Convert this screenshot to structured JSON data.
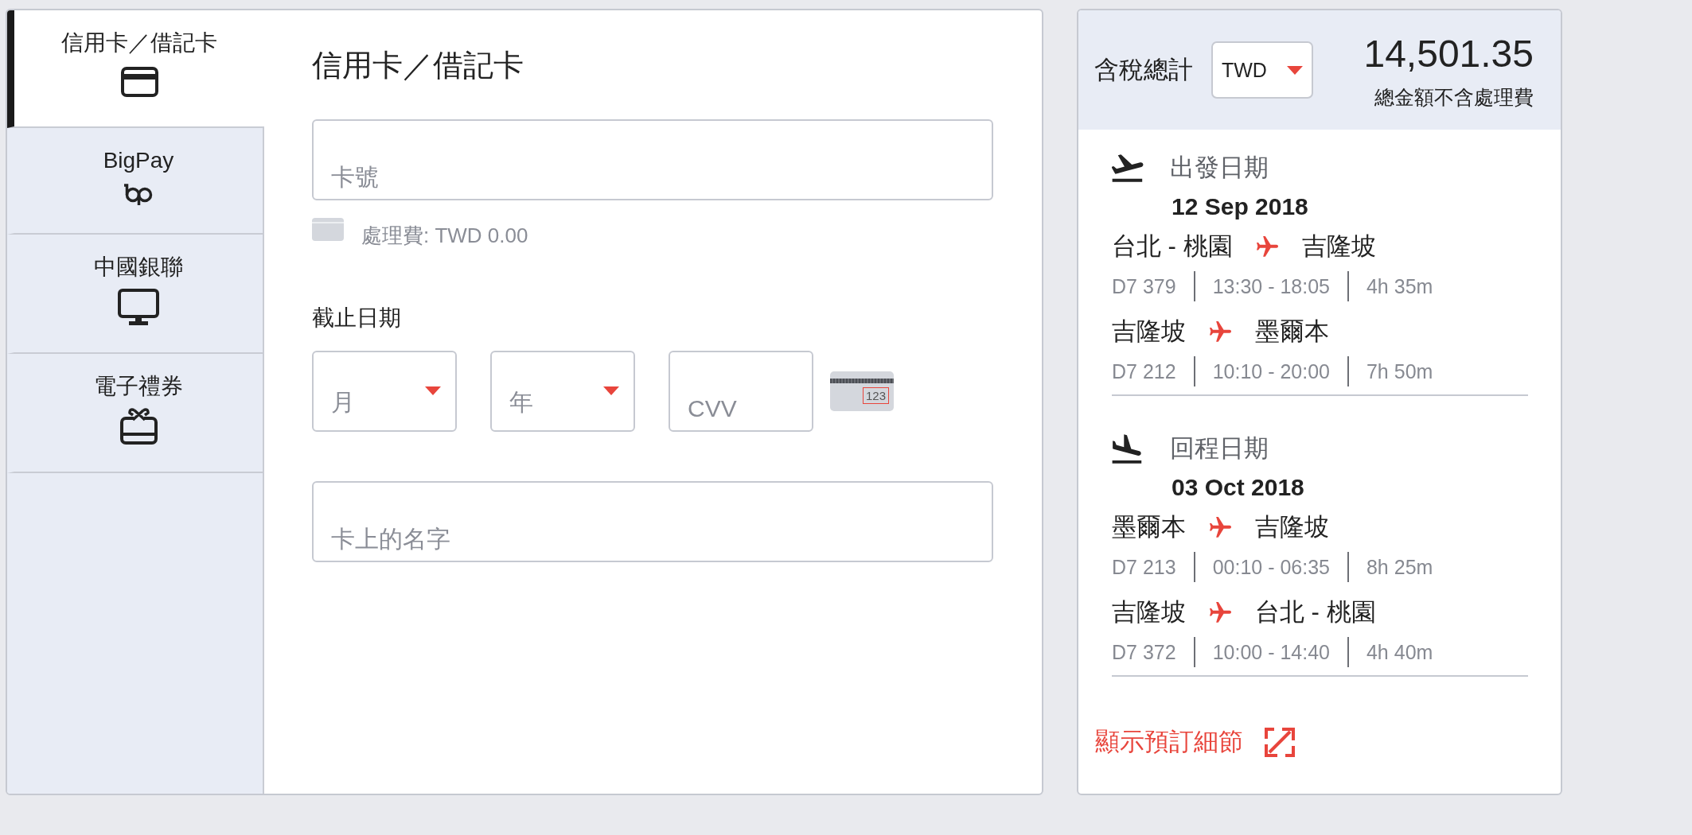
{
  "payment_tabs": [
    {
      "label": "信用卡／借記卡",
      "kind": "card",
      "selected": true
    },
    {
      "label": "BigPay",
      "kind": "bigpay",
      "selected": false
    },
    {
      "label": "中國銀聯",
      "kind": "unionpay",
      "selected": false
    },
    {
      "label": "電子禮券",
      "kind": "voucher",
      "selected": false
    }
  ],
  "card_form": {
    "title": "信用卡／借記卡",
    "card_number": {
      "placeholder": "卡號"
    },
    "fee": "處理費: TWD 0.00",
    "expiry": {
      "label": "截止日期",
      "month": {
        "placeholder": "月"
      },
      "year": {
        "placeholder": "年"
      }
    },
    "cvv": {
      "placeholder": "CVV",
      "example": "123"
    },
    "name_on_card": {
      "placeholder": "卡上的名字"
    }
  },
  "summary": {
    "total_label": "含稅總計",
    "currency": "TWD",
    "total": "14,501.35",
    "total_note": "總金額不含處理費",
    "trips": [
      {
        "kind": "departure",
        "label": "出發日期",
        "date": "12 Sep 2018",
        "segments": [
          {
            "from": "台北 - 桃園",
            "to": "吉隆坡",
            "flight": "D7 379",
            "time": "13:30 - 18:05",
            "duration": "4h 35m"
          },
          {
            "from": "吉隆坡",
            "to": "墨爾本",
            "flight": "D7 212",
            "time": "10:10 - 20:00",
            "duration": "7h 50m"
          }
        ]
      },
      {
        "kind": "return",
        "label": "回程日期",
        "date": "03 Oct 2018",
        "segments": [
          {
            "from": "墨爾本",
            "to": "吉隆坡",
            "flight": "D7 213",
            "time": "00:10 - 06:35",
            "duration": "8h 25m"
          },
          {
            "from": "吉隆坡",
            "to": "台北 - 桃園",
            "flight": "D7 372",
            "time": "10:00 - 14:40",
            "duration": "4h 40m"
          }
        ]
      }
    ],
    "details_link": "顯示預訂細節"
  }
}
